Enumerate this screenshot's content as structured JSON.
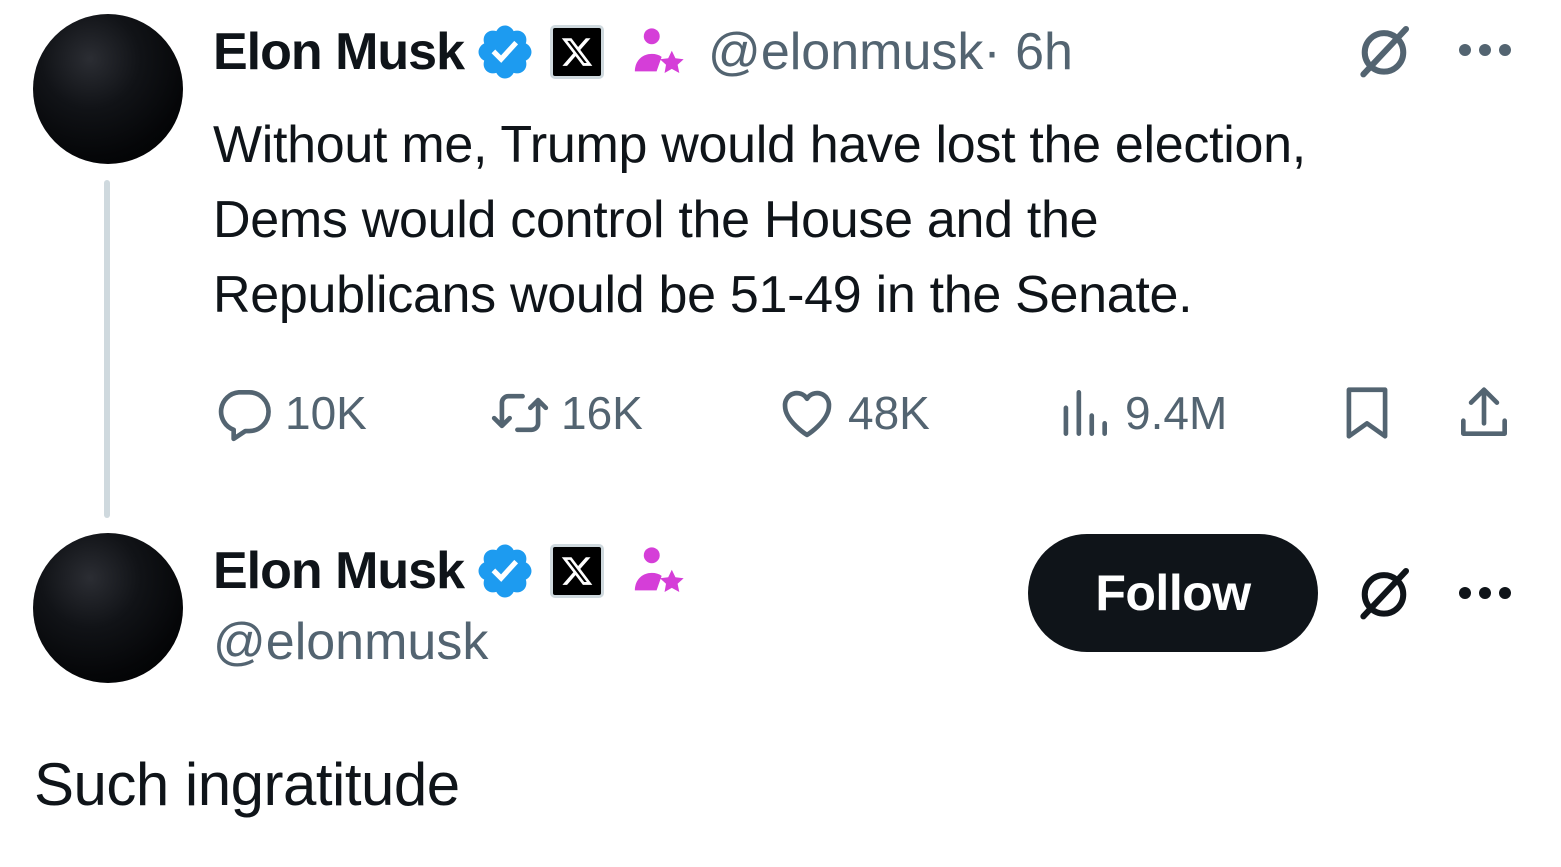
{
  "tweet": {
    "author_name": "Elon Musk",
    "handle": "@elonmusk",
    "time": " · 6h",
    "text": "Without me, Trump would have lost the election,\nDems would control the House and the\nRepublicans would be 51-49 in the Senate.",
    "metrics": {
      "replies": "10K",
      "reposts": "16K",
      "likes": "48K",
      "views": "9.4M"
    },
    "icons": [
      "verified-badge-icon",
      "x-affiliate-icon",
      "affiliate-person-star-icon",
      "grok-icon",
      "more-icon",
      "reply-icon",
      "repost-icon",
      "like-icon",
      "views-icon",
      "bookmark-icon",
      "share-icon"
    ]
  },
  "reply": {
    "author_name": "Elon Musk",
    "handle": "@elonmusk",
    "follow_label": "Follow",
    "text": "Such ingratitude"
  },
  "colors": {
    "text_primary": "#0f1419",
    "text_secondary": "#536471",
    "verified_blue": "#1d9bf0",
    "affiliate_magenta": "#d53ed8",
    "thread_line": "#cfd9de",
    "follow_bg": "#0f1419"
  }
}
